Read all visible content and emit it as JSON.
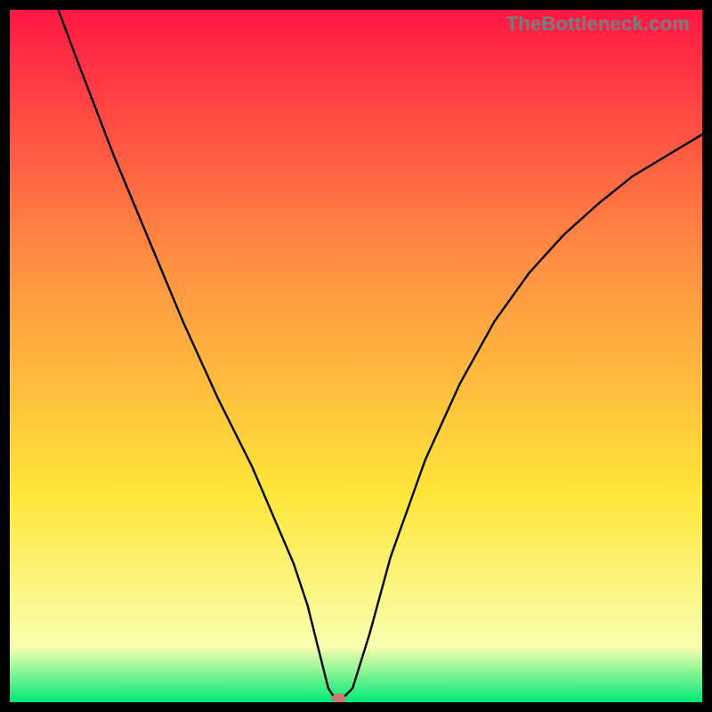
{
  "watermark": "TheBottleneck.com",
  "chart_data": {
    "type": "line",
    "title": "",
    "xlabel": "",
    "ylabel": "",
    "xlim": [
      0,
      100
    ],
    "ylim": [
      0,
      100
    ],
    "grid": false,
    "legend": false,
    "series": [
      {
        "name": "curve",
        "x": [
          7,
          10,
          15,
          20,
          25,
          30,
          35,
          38,
          41,
          43,
          44.5,
          46,
          47,
          48,
          49.5,
          52,
          55,
          60,
          65,
          70,
          75,
          80,
          85,
          90,
          95,
          100
        ],
        "y": [
          100,
          92,
          79,
          67,
          55,
          44,
          34,
          27,
          20,
          14,
          8,
          2,
          0.5,
          0.5,
          2,
          10,
          21,
          35,
          46,
          55,
          62,
          67.5,
          72,
          76,
          79,
          82
        ]
      }
    ],
    "marker": {
      "x": 47.5,
      "y": 0.5,
      "color": "#d07670"
    },
    "background_gradient_colors": [
      "#ff1744",
      "#ff9142",
      "#ffe63a",
      "#f9ffaf",
      "#00e977"
    ],
    "frame_color": "#000000",
    "curve_color": "#000000"
  }
}
